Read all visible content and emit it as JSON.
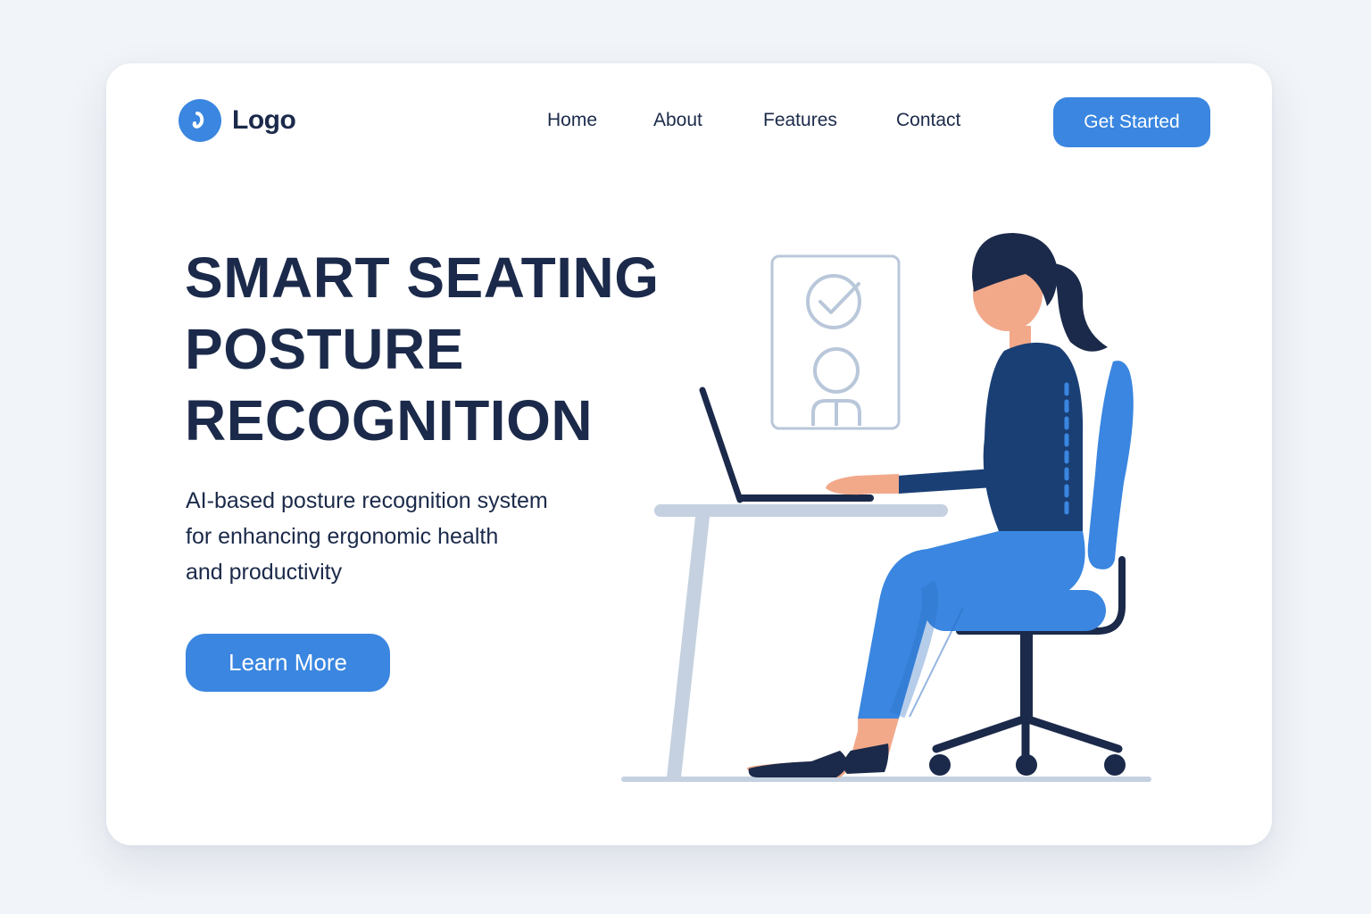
{
  "brand": {
    "logo_text": "Logo",
    "logo_icon": "logo-mark-icon",
    "accent": "#3a86e0",
    "dark": "#1b2a4a"
  },
  "nav": {
    "items": [
      {
        "label": "Home"
      },
      {
        "label": "About"
      },
      {
        "label": "Features"
      },
      {
        "label": "Contact"
      }
    ]
  },
  "header": {
    "cta_label": "Get Started"
  },
  "hero": {
    "title_lines": [
      "SMART SEATING",
      "POSTURE",
      "RECOGNITION"
    ],
    "subtitle_lines": [
      "AI-based posture recognition system",
      "for enhancing ergonomic health",
      "and productivity"
    ],
    "button_label": "Learn More"
  },
  "illustration": {
    "subject": "woman-seated-at-desk-with-laptop",
    "icons": [
      "checkmark-circle-icon",
      "person-silhouette-icon",
      "laptop-icon",
      "office-chair-icon"
    ]
  }
}
